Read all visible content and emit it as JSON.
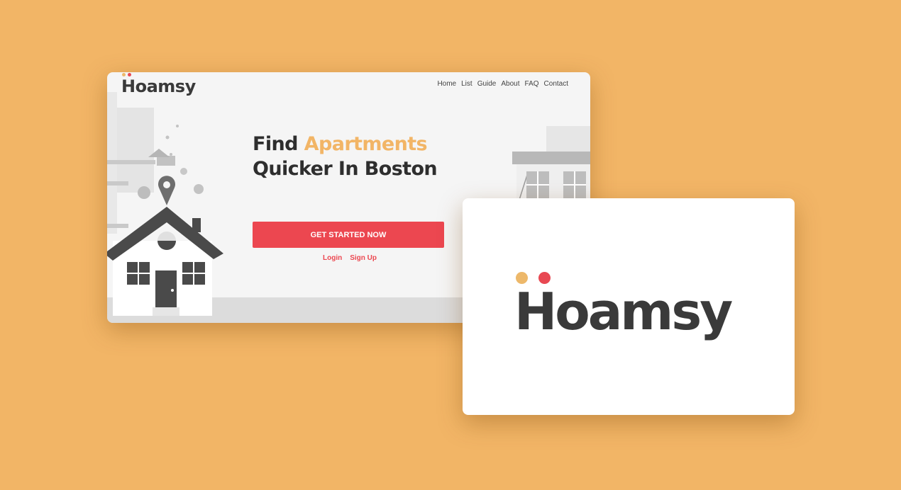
{
  "brand": {
    "name": "Hoamsy",
    "dot_colors": [
      "#EDB86A",
      "#E84852"
    ]
  },
  "nav": {
    "items": [
      "Home",
      "List",
      "Guide",
      "About",
      "FAQ",
      "Contact"
    ]
  },
  "hero": {
    "title_word1": "Find",
    "title_accent": "Apartments",
    "title_line2": "Quicker In Boston",
    "cta_label": "GET STARTED NOW",
    "login_label": "Login",
    "signup_label": "Sign Up"
  },
  "colors": {
    "background": "#F2B566",
    "accent": "#F2B566",
    "cta": "#EC4750",
    "text_dark": "#2E2E2E"
  },
  "icons": [
    "house-illustration",
    "map-pin-icon",
    "building-illustration"
  ]
}
